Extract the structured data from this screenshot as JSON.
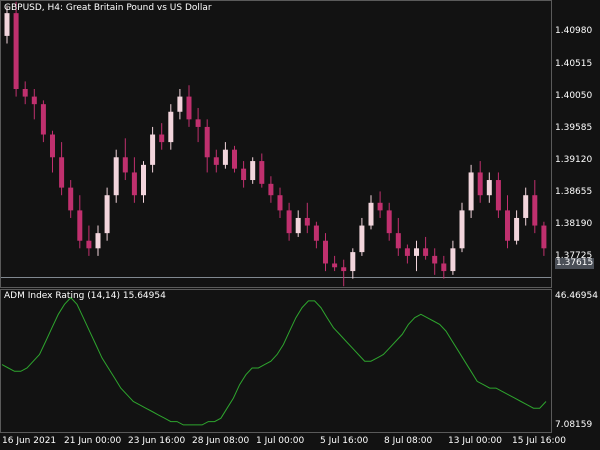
{
  "chart": {
    "title": "GBPUSD, H4:  Great Britain Pound vs US Dollar",
    "price_labels": [
      "1.40980",
      "1.40515",
      "1.40050",
      "1.39585",
      "1.39120",
      "1.38655",
      "1.38190",
      "1.37725"
    ],
    "current_price": "1.37615",
    "colors": {
      "background": "#121212",
      "bull": "#f2d5dc",
      "bear": "#c0306e",
      "grid": "#5a5a5a",
      "indicator": "#2ea52e"
    }
  },
  "indicator": {
    "label": "ADM Index Rating (14,14) 15.64954",
    "high_label": "46.46954",
    "low_label": "7.08159"
  },
  "time_axis": {
    "labels": [
      "16 Jun 2021",
      "21 Jun 00:00",
      "23 Jun 16:00",
      "28 Jun 08:00",
      "1 Jul 00:00",
      "5 Jul 16:00",
      "8 Jul 08:00",
      "13 Jul 00:00",
      "15 Jul 16:00"
    ]
  },
  "chart_data": [
    {
      "type": "candlestick",
      "title": "GBPUSD, H4:  Great Britain Pound vs US Dollar",
      "ylim": [
        1.3749,
        1.4126
      ],
      "ohlc_bars": [
        [
          1.408,
          1.412,
          1.407,
          1.411
        ],
        [
          1.411,
          1.4125,
          1.4,
          1.401
        ],
        [
          1.401,
          1.402,
          1.399,
          1.4
        ],
        [
          1.4,
          1.401,
          1.397,
          1.399
        ],
        [
          1.399,
          1.3995,
          1.394,
          1.395
        ],
        [
          1.395,
          1.3955,
          1.39,
          1.392
        ],
        [
          1.392,
          1.394,
          1.387,
          1.388
        ],
        [
          1.388,
          1.389,
          1.384,
          1.385
        ],
        [
          1.385,
          1.387,
          1.38,
          1.381
        ],
        [
          1.381,
          1.383,
          1.379,
          1.38
        ],
        [
          1.38,
          1.383,
          1.379,
          1.382
        ],
        [
          1.382,
          1.388,
          1.381,
          1.387
        ],
        [
          1.387,
          1.393,
          1.386,
          1.392
        ],
        [
          1.392,
          1.3945,
          1.389,
          1.39
        ],
        [
          1.39,
          1.392,
          1.386,
          1.387
        ],
        [
          1.387,
          1.3915,
          1.386,
          1.391
        ],
        [
          1.391,
          1.396,
          1.39,
          1.395
        ],
        [
          1.395,
          1.3965,
          1.393,
          1.394
        ],
        [
          1.394,
          1.399,
          1.393,
          1.398
        ],
        [
          1.398,
          1.401,
          1.397,
          1.4
        ],
        [
          1.4,
          1.4015,
          1.396,
          1.397
        ],
        [
          1.397,
          1.3985,
          1.394,
          1.396
        ],
        [
          1.396,
          1.397,
          1.39,
          1.392
        ],
        [
          1.392,
          1.393,
          1.39,
          1.391
        ],
        [
          1.391,
          1.394,
          1.3905,
          1.393
        ],
        [
          1.393,
          1.3935,
          1.39,
          1.3905
        ],
        [
          1.3905,
          1.3915,
          1.388,
          1.389
        ],
        [
          1.389,
          1.392,
          1.3885,
          1.3915
        ],
        [
          1.3915,
          1.3925,
          1.388,
          1.3885
        ],
        [
          1.3885,
          1.3895,
          1.386,
          1.387
        ],
        [
          1.387,
          1.388,
          1.384,
          1.385
        ],
        [
          1.385,
          1.386,
          1.381,
          1.382
        ],
        [
          1.382,
          1.385,
          1.3815,
          1.384
        ],
        [
          1.384,
          1.386,
          1.382,
          1.383
        ],
        [
          1.383,
          1.3835,
          1.38,
          1.381
        ],
        [
          1.381,
          1.382,
          1.377,
          1.378
        ],
        [
          1.378,
          1.379,
          1.377,
          1.3775
        ],
        [
          1.3775,
          1.3785,
          1.375,
          1.377
        ],
        [
          1.377,
          1.38,
          1.376,
          1.3795
        ],
        [
          1.3795,
          1.384,
          1.379,
          1.383
        ],
        [
          1.383,
          1.387,
          1.3825,
          1.386
        ],
        [
          1.386,
          1.3875,
          1.384,
          1.385
        ],
        [
          1.385,
          1.386,
          1.381,
          1.382
        ],
        [
          1.382,
          1.384,
          1.379,
          1.38
        ],
        [
          1.38,
          1.3805,
          1.378,
          1.379
        ],
        [
          1.379,
          1.381,
          1.377,
          1.38
        ],
        [
          1.38,
          1.3815,
          1.3785,
          1.379
        ],
        [
          1.379,
          1.38,
          1.3765,
          1.378
        ],
        [
          1.378,
          1.379,
          1.376,
          1.377
        ],
        [
          1.377,
          1.381,
          1.3765,
          1.38
        ],
        [
          1.38,
          1.386,
          1.3795,
          1.385
        ],
        [
          1.385,
          1.391,
          1.384,
          1.39
        ],
        [
          1.39,
          1.3915,
          1.386,
          1.387
        ],
        [
          1.387,
          1.39,
          1.386,
          1.389
        ],
        [
          1.389,
          1.39,
          1.384,
          1.385
        ],
        [
          1.385,
          1.387,
          1.38,
          1.381
        ],
        [
          1.381,
          1.385,
          1.3805,
          1.384
        ],
        [
          1.384,
          1.388,
          1.383,
          1.387
        ],
        [
          1.387,
          1.389,
          1.382,
          1.383
        ],
        [
          1.383,
          1.3835,
          1.379,
          1.38
        ]
      ]
    },
    {
      "type": "line",
      "title": "ADM Index Rating (14,14) 15.64954",
      "ylim": [
        7.08159,
        46.46954
      ],
      "series": [
        {
          "values": [
            26,
            25,
            24,
            24,
            25,
            27,
            29,
            33,
            37,
            41,
            44,
            46,
            44,
            40,
            36,
            32,
            28,
            25,
            22,
            19,
            17,
            15,
            14,
            13,
            12,
            11,
            10,
            9,
            9,
            8,
            8,
            8,
            8,
            9,
            9,
            10,
            13,
            16,
            20,
            23,
            25,
            25,
            26,
            27,
            29,
            32,
            36,
            40,
            43,
            45,
            45,
            43,
            40,
            37,
            35,
            33,
            31,
            29,
            27,
            27,
            28,
            29,
            31,
            33,
            35,
            38,
            40,
            41,
            40,
            39,
            38,
            36,
            33,
            30,
            27,
            24,
            21,
            20,
            19,
            19,
            18,
            17,
            16,
            15,
            14,
            13,
            13,
            15
          ]
        }
      ]
    }
  ]
}
